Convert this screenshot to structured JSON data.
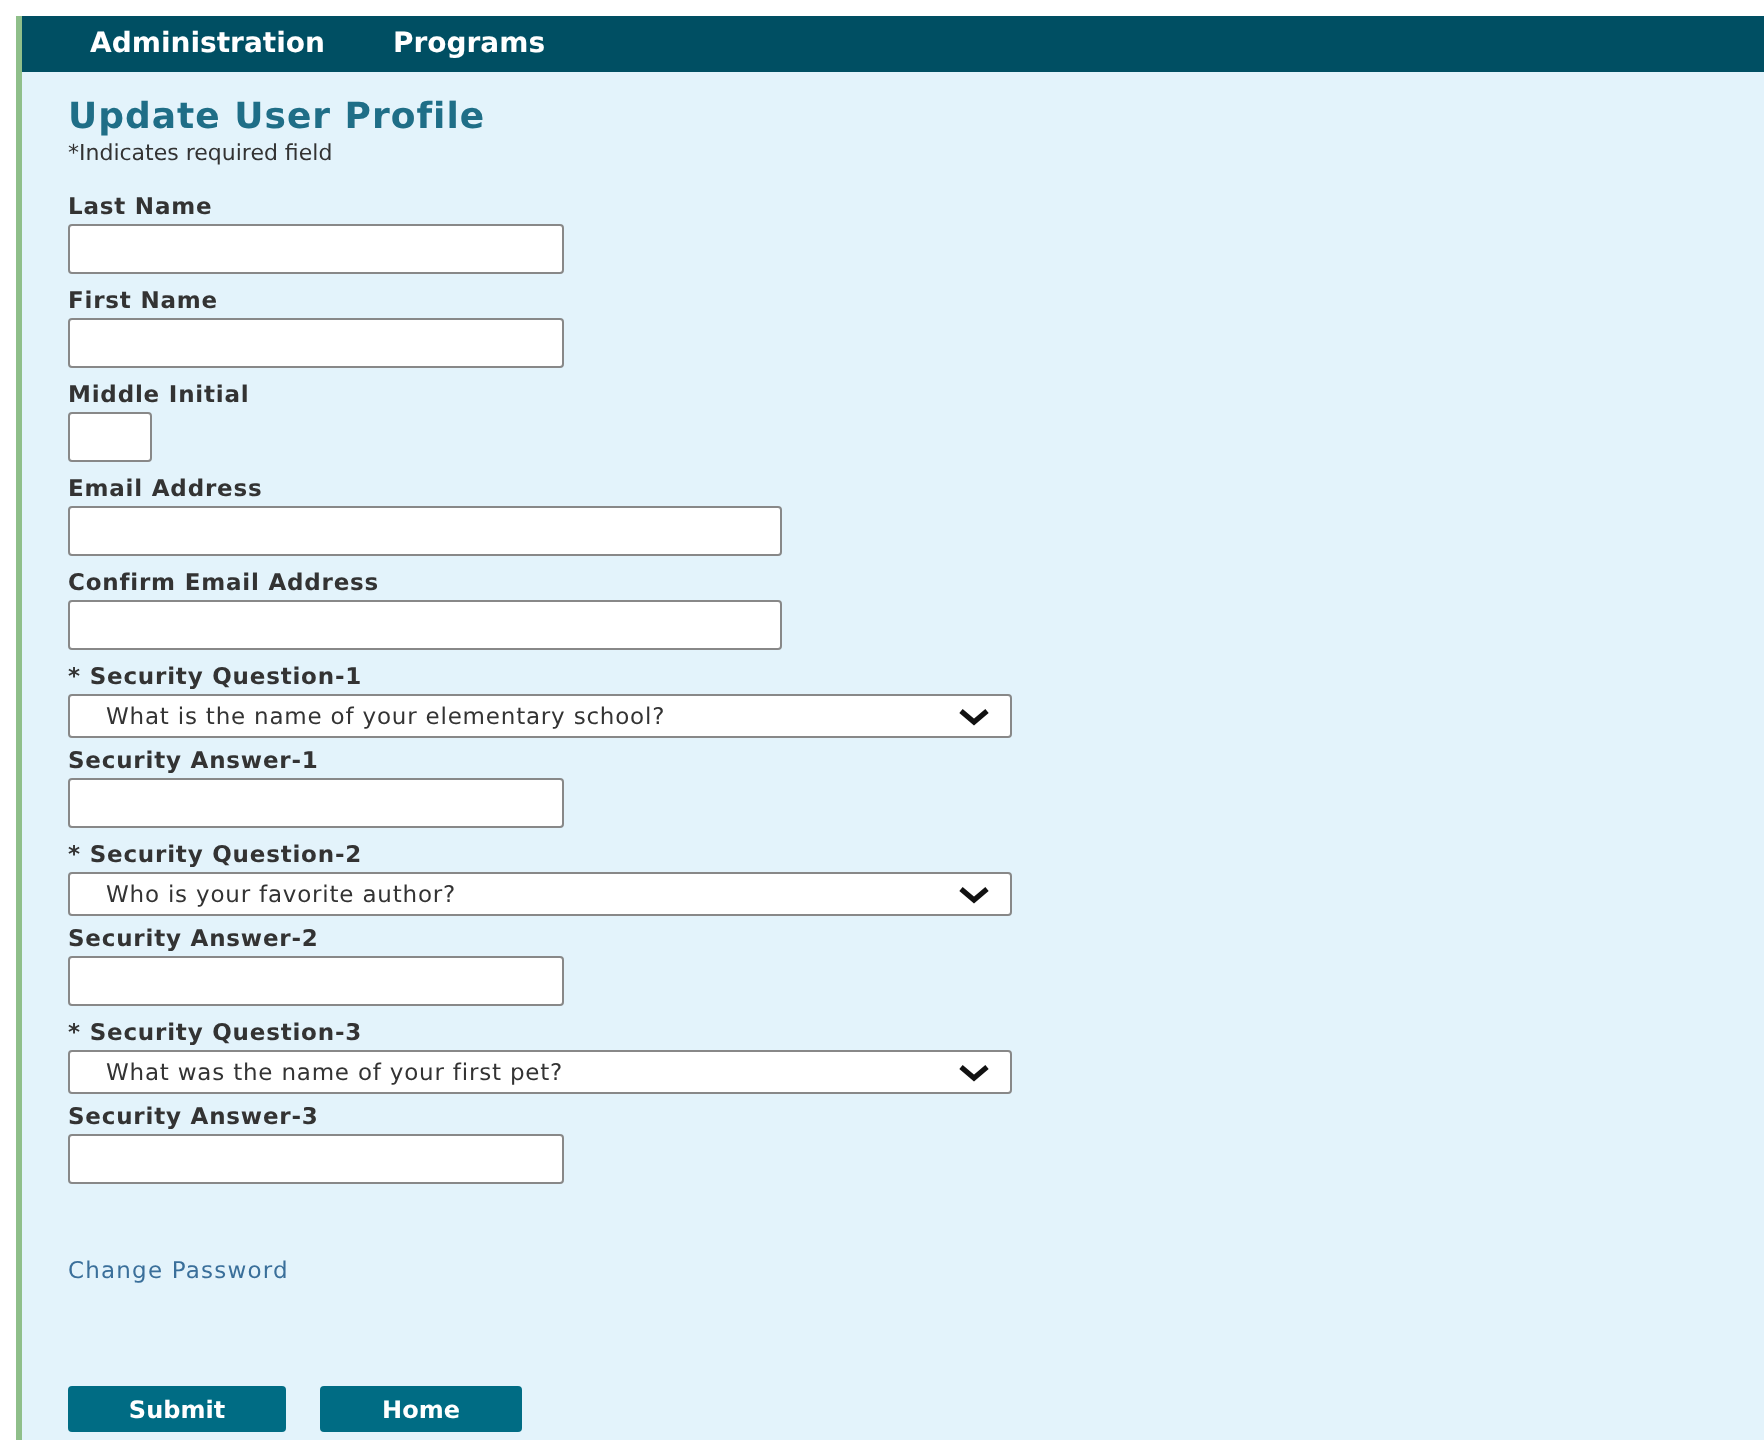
{
  "nav": {
    "items": [
      "Administration",
      "Programs"
    ]
  },
  "form": {
    "title": "Update User Profile",
    "note": "*Indicates required field",
    "fields": [
      {
        "kind": "short",
        "label": "Last Name"
      },
      {
        "kind": "short",
        "label": "First Name"
      },
      {
        "kind": "tiny",
        "label": "Middle Initial"
      },
      {
        "kind": "long",
        "label": "Email Address"
      },
      {
        "kind": "long",
        "label": "Confirm Email Address"
      },
      {
        "kind": "select",
        "label": "* Security Question-1",
        "value": "What is the name of your elementary school?"
      },
      {
        "kind": "short",
        "label": "Security Answer-1"
      },
      {
        "kind": "select",
        "label": "* Security Question-2",
        "value": "Who is your favorite author?"
      },
      {
        "kind": "short",
        "label": "Security Answer-2"
      },
      {
        "kind": "select",
        "label": "* Security Question-3",
        "value": "What was the name of your first pet?"
      },
      {
        "kind": "short",
        "label": "Security Answer-3"
      }
    ],
    "link": "Change Password",
    "buttons": [
      "Submit",
      "Home"
    ]
  }
}
